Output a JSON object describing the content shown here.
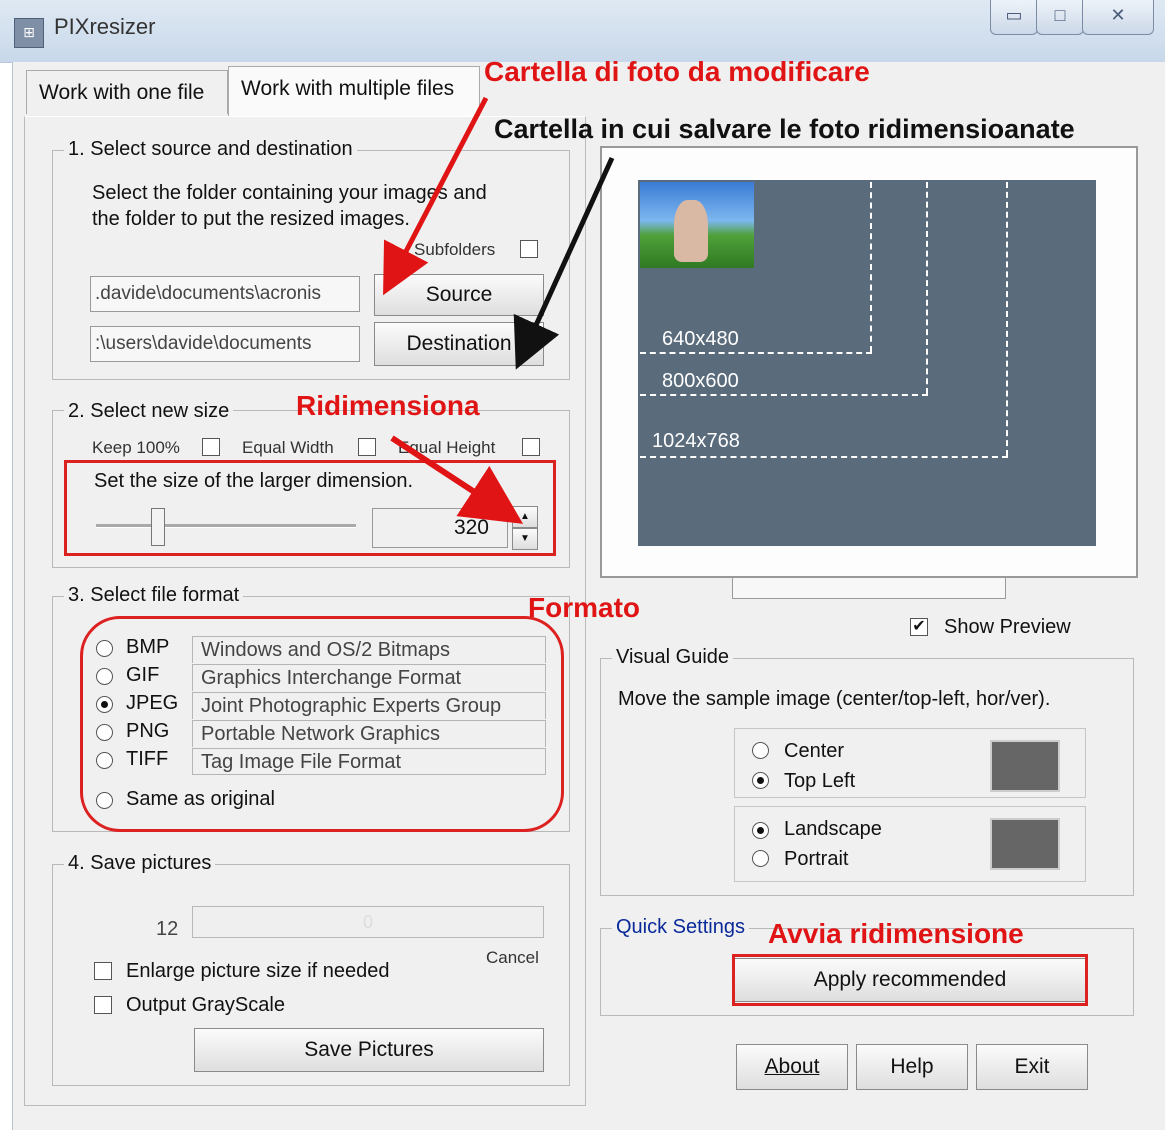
{
  "window": {
    "title": "PIXresizer",
    "minimize": "▭",
    "maximize": "□",
    "close": "✕"
  },
  "tabs": [
    {
      "label": "Work with one file"
    },
    {
      "label": "Work with multiple files"
    }
  ],
  "source_dest": {
    "legend": "1. Select source and destination",
    "description_line1": "Select the folder containing your images and",
    "description_line2": "the folder to put the resized images.",
    "subfolders_label": "Subfolders",
    "source_path": ".davide\\documents\\acronis",
    "dest_path": ":\\users\\davide\\documents",
    "source_button": "Source",
    "destination_button": "Destination"
  },
  "new_size": {
    "legend": "2. Select new size",
    "keep100_label": "Keep 100%",
    "equal_width_label": "Equal Width",
    "equal_height_label": "Equal Height",
    "larger_dim_label": "Set the size of the larger dimension.",
    "size_value": "320",
    "slider_level": 0.25
  },
  "file_format": {
    "legend": "3. Select file format",
    "options": [
      {
        "code": "BMP",
        "desc": "Windows and OS/2 Bitmaps",
        "checked": false
      },
      {
        "code": "GIF",
        "desc": "Graphics Interchange Format",
        "checked": false
      },
      {
        "code": "JPEG",
        "desc": "Joint Photographic Experts Group",
        "checked": true
      },
      {
        "code": "PNG",
        "desc": "Portable Network Graphics",
        "checked": false
      },
      {
        "code": "TIFF",
        "desc": "Tag Image File Format",
        "checked": false
      }
    ],
    "same_as_original": "Same as original"
  },
  "save": {
    "legend": "4. Save pictures",
    "count": "12",
    "progress_text": "0",
    "cancel": "Cancel",
    "enlarge_label": "Enlarge picture size if needed",
    "grayscale_label": "Output GrayScale",
    "save_button": "Save Pictures"
  },
  "preview": {
    "labels": [
      "640x480",
      "800x600",
      "1024x768"
    ],
    "show_preview_label": "Show Preview",
    "show_preview_checked": true
  },
  "visual_guide": {
    "legend": "Visual Guide",
    "description": "Move the sample image (center/top-left, hor/ver).",
    "center": "Center",
    "top_left": "Top Left",
    "landscape": "Landscape",
    "portrait": "Portrait"
  },
  "quick_settings": {
    "legend": "Quick Settings",
    "apply_button": "Apply recommended"
  },
  "footer_buttons": {
    "about": "About",
    "help": "Help",
    "exit": "Exit"
  },
  "annotations": {
    "source_folder": "Cartella di foto da modificare",
    "dest_folder": "Cartella in cui salvare le foto ridimensioanate",
    "resize": "Ridimensiona",
    "format": "Formato",
    "start": "Avvia ridimensione"
  },
  "colors": {
    "annotation_red": "#e01414",
    "preview_bg": "#5a6b7c",
    "quick_settings_blue": "#0a2a9a"
  }
}
